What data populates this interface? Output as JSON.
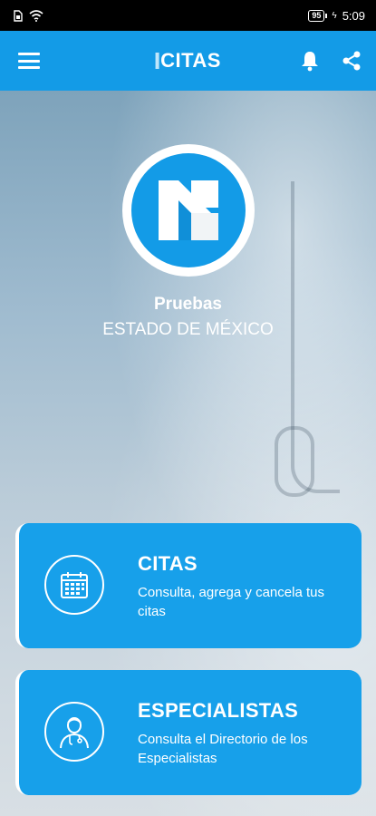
{
  "status_bar": {
    "time": "5:09",
    "battery": "95"
  },
  "app_bar": {
    "logo_text": "CITAS",
    "icons": [
      "menu-icon",
      "bell-icon",
      "share-icon"
    ]
  },
  "organization": {
    "name": "Pruebas",
    "location": "ESTADO DE MÉXICO"
  },
  "cards": [
    {
      "title": "CITAS",
      "description": "Consulta, agrega y cancela tus citas",
      "icon": "calendar-icon"
    },
    {
      "title": "ESPECIALISTAS",
      "description": "Consulta el Directorio de los Especialistas",
      "icon": "doctor-icon"
    }
  ],
  "colors": {
    "primary": "#139be7",
    "card": "#17a0ea",
    "status_bar": "#000000"
  }
}
